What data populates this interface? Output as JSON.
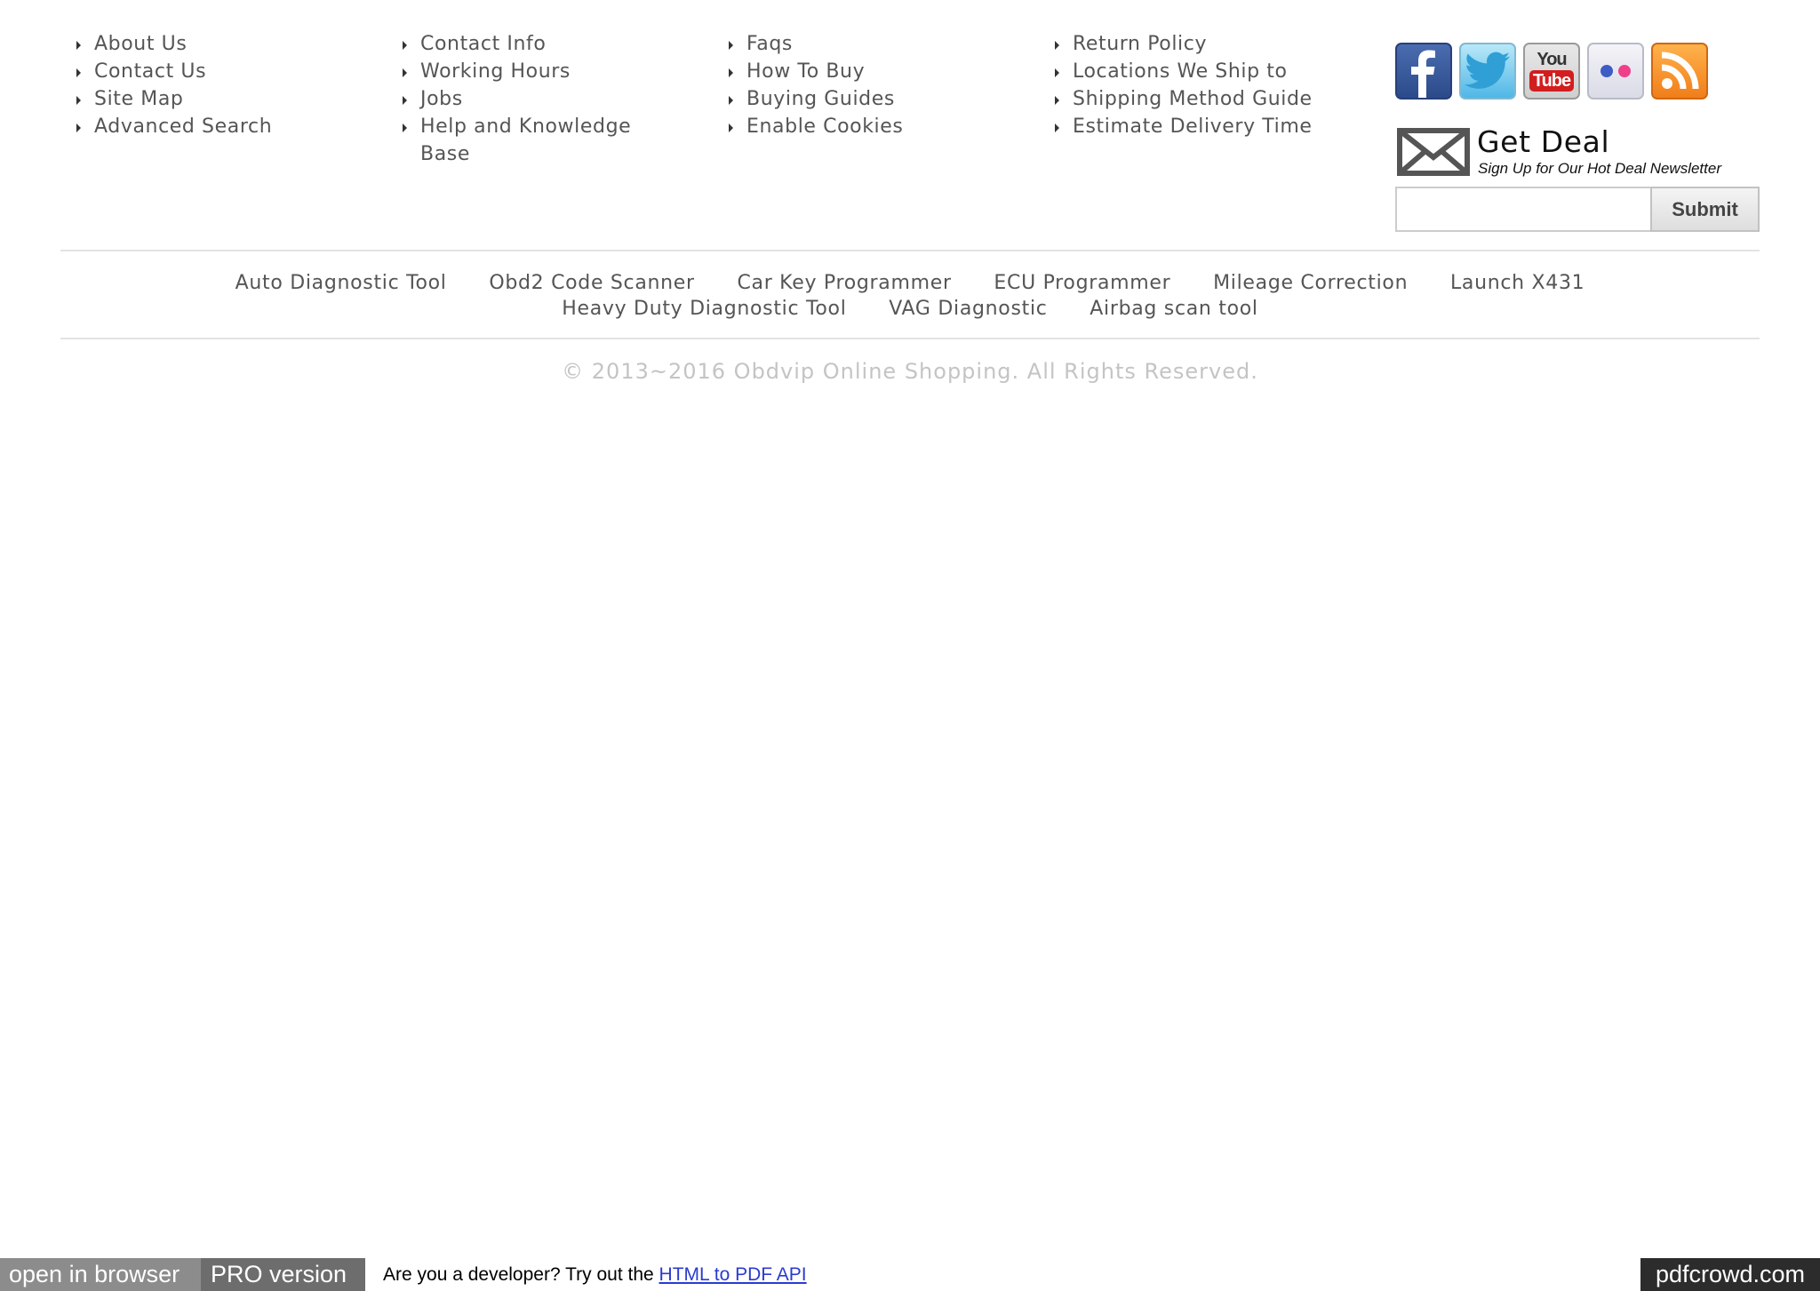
{
  "footer": {
    "columns": [
      {
        "items": [
          "About Us",
          "Contact Us",
          "Site Map",
          "Advanced Search"
        ]
      },
      {
        "items": [
          "Contact Info",
          "Working Hours",
          "Jobs",
          "Help and Knowledge Base"
        ]
      },
      {
        "items": [
          "Faqs",
          "How To Buy",
          "Buying Guides",
          "Enable Cookies"
        ]
      },
      {
        "items": [
          "Return Policy",
          "Locations We Ship to",
          "Shipping Method Guide",
          "Estimate Delivery Time"
        ]
      }
    ]
  },
  "social": {
    "icons": [
      "facebook-icon",
      "twitter-icon",
      "youtube-icon",
      "flickr-icon",
      "rss-icon"
    ],
    "youtube_top": "You",
    "youtube_bottom": "Tube"
  },
  "deal": {
    "title": "Get Deal",
    "subtitle": "Sign Up for Our Hot Deal Newsletter",
    "input_value": "",
    "submit_label": "Submit"
  },
  "categories": [
    "Auto Diagnostic Tool",
    "Obd2 Code Scanner",
    "Car Key Programmer",
    "ECU Programmer",
    "Mileage Correction",
    "Launch X431",
    "Heavy Duty Diagnostic Tool",
    "VAG Diagnostic",
    "Airbag scan tool"
  ],
  "copyright": "© 2013~2016 Obdvip Online Shopping. All Rights Reserved.",
  "pdfcrowd": {
    "open_in_browser": "open in browser",
    "pro_version": "PRO version",
    "dev_text": "Are you a developer? Try out the",
    "api_link": "HTML to PDF API",
    "brand": "pdfcrowd.com"
  },
  "colors": {
    "text": "#555555",
    "copyright": "#c4c4c4",
    "link_blue": "#2a3bd0"
  }
}
